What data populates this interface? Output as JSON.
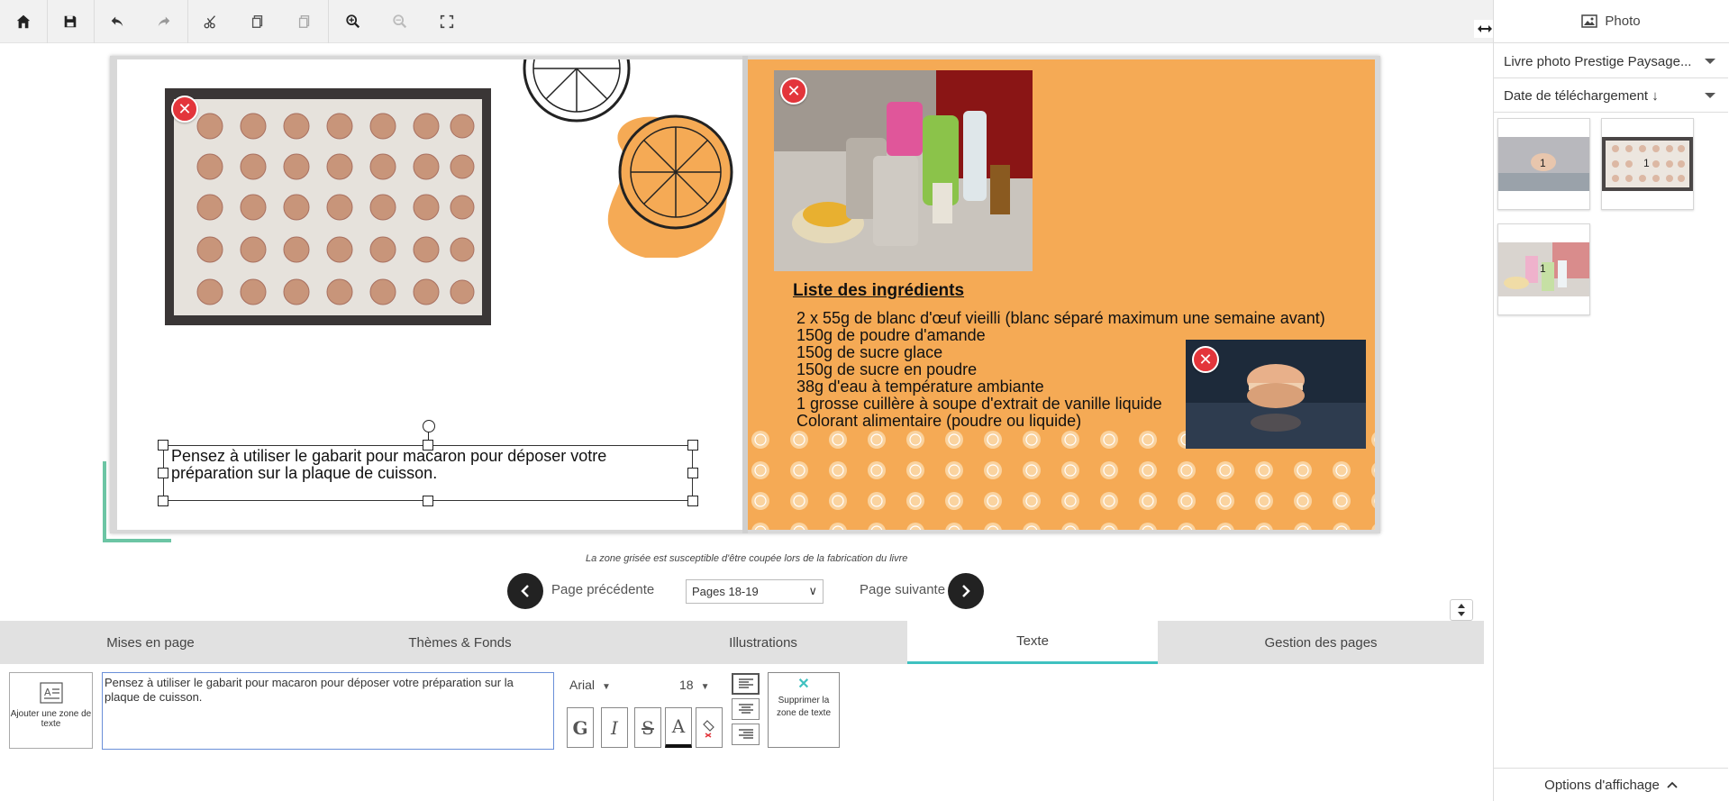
{
  "toolbar": {
    "icons": [
      "home-icon",
      "save-icon",
      "undo-icon",
      "redo-icon",
      "cut-icon",
      "copy-icon",
      "paste-icon",
      "zoom-in-icon",
      "zoom-out-icon",
      "fullscreen-icon"
    ]
  },
  "canvas": {
    "ingredients_title": "Liste des ingrédients",
    "ingredients": [
      "2 x 55g de blanc d'œuf vieilli (blanc séparé maximum une semaine avant)",
      "150g de poudre d'amande",
      "150g de sucre glace",
      "150g de sucre en poudre",
      "38g d'eau à température ambiante",
      "1 grosse cuillère à soupe d'extrait de vanille liquide",
      "Colorant alimentaire (poudre ou liquide)"
    ],
    "text_box": "Pensez à utiliser le gabarit pour macaron pour déposer votre préparation sur la plaque de cuisson.",
    "crop_note": "La zone grisée est susceptible d'être coupée lors de la fabrication du livre",
    "colors": {
      "right_page_bg": "#f5aa55",
      "delete_badge": "#e3353b",
      "bleed_mark": "#6cc5a4"
    }
  },
  "nav": {
    "prev_label": "Page précédente",
    "next_label": "Page suivante",
    "page_selected": "Pages 18-19"
  },
  "tabs": [
    {
      "label": "Mises en page"
    },
    {
      "label": "Thèmes & Fonds"
    },
    {
      "label": "Illustrations"
    },
    {
      "label": "Texte",
      "active": true
    },
    {
      "label": "Gestion des pages"
    }
  ],
  "text_tools": {
    "add_text_label": "Ajouter une zone de texte",
    "text_value": "Pensez à utiliser le gabarit pour macaron pour déposer votre préparation sur la plaque de cuisson.",
    "font": "Arial",
    "size": "18",
    "format_buttons": [
      "G",
      "I",
      "S",
      "A"
    ],
    "delete_label": "Supprimer la zone de texte"
  },
  "right_panel": {
    "title": "Photo",
    "album_select": "Livre photo Prestige Paysage...",
    "sort_select": "Date de téléchargement ↓",
    "thumb_counts": [
      "1",
      "1",
      "1"
    ],
    "display_options": "Options d'affichage"
  },
  "fab_label": "+"
}
